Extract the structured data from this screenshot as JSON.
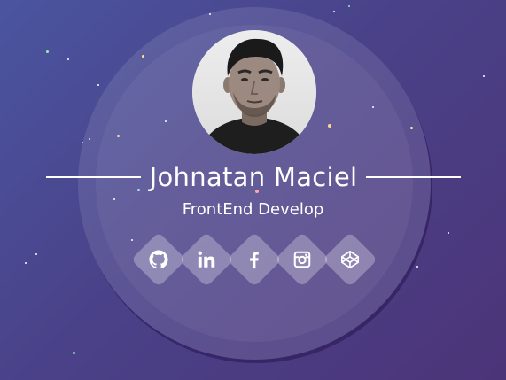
{
  "profile": {
    "name": "Johnatan Maciel",
    "role": "FrontEnd Develop"
  },
  "socials": [
    {
      "icon": "github-icon"
    },
    {
      "icon": "linkedin-icon"
    },
    {
      "icon": "facebook-icon"
    },
    {
      "icon": "instagram-icon"
    },
    {
      "icon": "codepen-icon"
    }
  ],
  "colors": {
    "background_start": "#4a55a0",
    "background_end": "#4c3478",
    "text": "#ffffff"
  }
}
